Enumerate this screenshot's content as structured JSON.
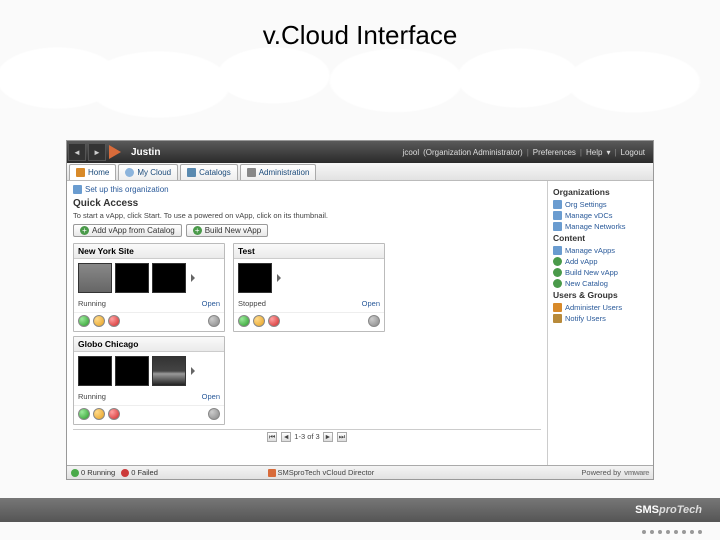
{
  "slide": {
    "title": "v.Cloud Interface"
  },
  "topbar": {
    "org": "Justin",
    "user": "jcool",
    "role": "(Organization Administrator)",
    "prefs": "Preferences",
    "help": "Help",
    "logout": "Logout"
  },
  "tabs": {
    "home": "Home",
    "mycloud": "My Cloud",
    "catalogs": "Catalogs",
    "admin": "Administration"
  },
  "setup": {
    "label": "Set up this organization"
  },
  "quick": {
    "title": "Quick Access",
    "subtitle": "To start a vApp, click Start. To use a powered on vApp, click on its thumbnail.",
    "addFromCatalog": "Add vApp from Catalog",
    "buildNew": "Build New vApp"
  },
  "vapps": [
    {
      "name": "New York Site",
      "status": "Running",
      "action": "Open"
    },
    {
      "name": "Test",
      "status": "Stopped",
      "action": "Open"
    },
    {
      "name": "Globo Chicago",
      "status": "Running",
      "action": "Open"
    }
  ],
  "pager": {
    "text": "1-3 of 3"
  },
  "side": {
    "orgHead": "Organizations",
    "orgSettings": "Org Settings",
    "manageVdcs": "Manage vDCs",
    "manageNetworks": "Manage Networks",
    "contentHead": "Content",
    "manageVapps": "Manage vApps",
    "addVapp": "Add vApp",
    "buildVapp": "Build New vApp",
    "newCatalog": "New Catalog",
    "usersHead": "Users & Groups",
    "adminUsers": "Administer Users",
    "notifyUsers": "Notify Users"
  },
  "status": {
    "running": "0 Running",
    "failed": "0 Failed",
    "product": "SMSproTech vCloud Director",
    "poweredBy": "Powered by",
    "vendor": "vmware"
  },
  "footer": {
    "brandA": "SMS",
    "brandB": "proTech"
  }
}
